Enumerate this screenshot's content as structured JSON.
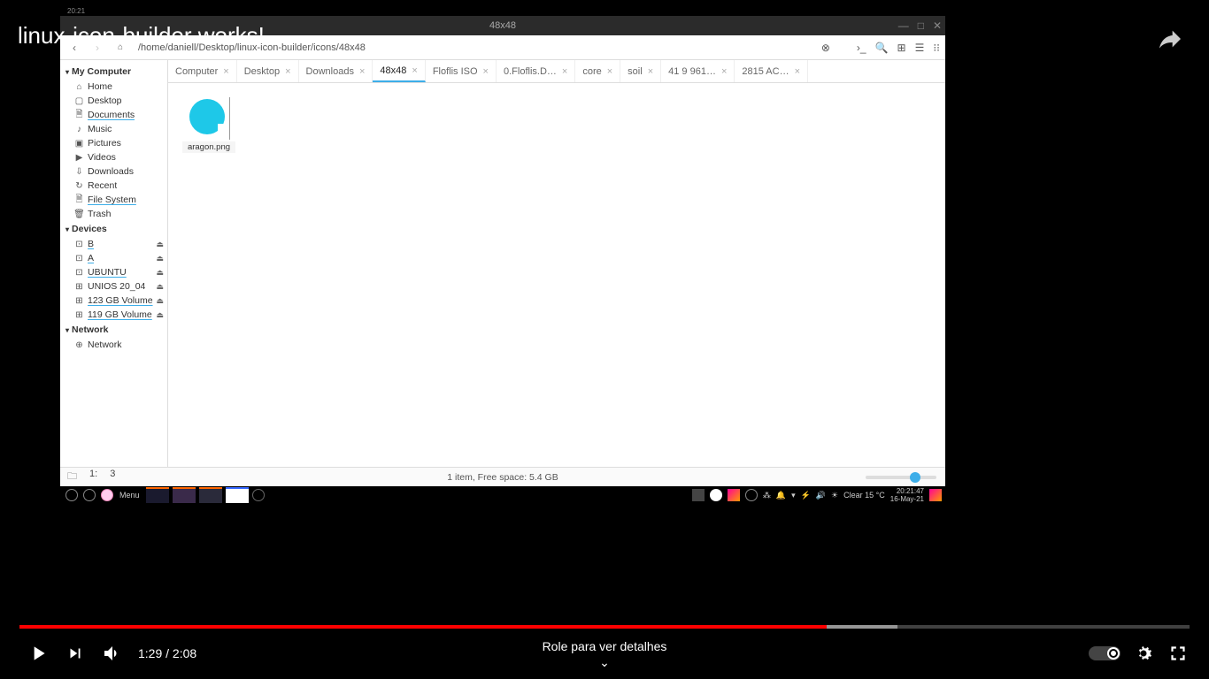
{
  "video_title": "linux-icon-builder works!",
  "sys_time_top": "20:21",
  "window_title": "48x48",
  "path": "/home/daniell/Desktop/linux-icon-builder/icons/48x48",
  "sidebar": {
    "sections": [
      {
        "title": "My Computer",
        "items": [
          {
            "icon": "⌂",
            "label": "Home"
          },
          {
            "icon": "▢",
            "label": "Desktop"
          },
          {
            "icon": "🗎",
            "label": "Documents",
            "ul": true
          },
          {
            "icon": "♪",
            "label": "Music"
          },
          {
            "icon": "▣",
            "label": "Pictures"
          },
          {
            "icon": "▶",
            "label": "Videos"
          },
          {
            "icon": "⇩",
            "label": "Downloads"
          },
          {
            "icon": "↻",
            "label": "Recent"
          },
          {
            "icon": "🗎",
            "label": "File System",
            "ul": true
          },
          {
            "icon": "🗑",
            "label": "Trash"
          }
        ]
      },
      {
        "title": "Devices",
        "items": [
          {
            "icon": "⊡",
            "label": "B",
            "ul": true,
            "eject": true
          },
          {
            "icon": "⊡",
            "label": "A",
            "ul": true,
            "eject": true
          },
          {
            "icon": "⊡",
            "label": "UBUNTU",
            "ul": true,
            "eject": true
          },
          {
            "icon": "⊞",
            "label": "UNIOS 20_04",
            "eject": true
          },
          {
            "icon": "⊞",
            "label": "123 GB Volume",
            "ul": true,
            "eject": true
          },
          {
            "icon": "⊞",
            "label": "119 GB Volume",
            "ul": true,
            "eject": true
          }
        ]
      },
      {
        "title": "Network",
        "items": [
          {
            "icon": "⊕",
            "label": "Network"
          }
        ]
      }
    ]
  },
  "tabs": [
    {
      "label": "Computer"
    },
    {
      "label": "Desktop"
    },
    {
      "label": "Downloads"
    },
    {
      "label": "48x48",
      "active": true
    },
    {
      "label": "Floflis ISO"
    },
    {
      "label": "0.Floflis.D…"
    },
    {
      "label": "core"
    },
    {
      "label": "soil"
    },
    {
      "label": "41 9 961…"
    },
    {
      "label": "2815 AC…"
    }
  ],
  "file": {
    "name": "aragon.png"
  },
  "statusbar": {
    "left_icon": "🗀",
    "left_items": [
      "1:",
      "3"
    ],
    "center": "1 item, Free space: 5.4 GB"
  },
  "taskbar": {
    "menu_label": "Menu",
    "weather": "Clear 15 °C",
    "clock_time": "20:21:47",
    "clock_date": "16-May-21"
  },
  "player": {
    "current": "1:29",
    "duration": "2:08",
    "scroll_hint": "Role para ver detalhes"
  }
}
